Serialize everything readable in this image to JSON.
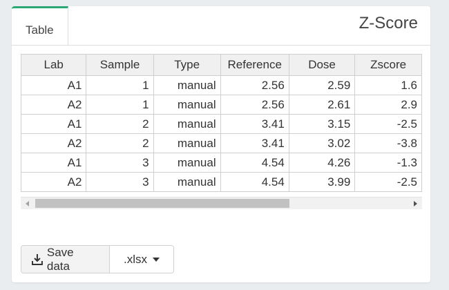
{
  "tabs": [
    {
      "label": "Table"
    }
  ],
  "panel": {
    "title": "Z-Score"
  },
  "table": {
    "columns": [
      "Lab",
      "Sample",
      "Type",
      "Reference",
      "Dose",
      "Zscore"
    ],
    "rows": [
      [
        "A1",
        "1",
        "manual",
        "2.56",
        "2.59",
        "1.6"
      ],
      [
        "A2",
        "1",
        "manual",
        "2.56",
        "2.61",
        "2.9"
      ],
      [
        "A1",
        "2",
        "manual",
        "3.41",
        "3.15",
        "-2.5"
      ],
      [
        "A2",
        "2",
        "manual",
        "3.41",
        "3.02",
        "-3.8"
      ],
      [
        "A1",
        "3",
        "manual",
        "4.54",
        "4.26",
        "-1.3"
      ],
      [
        "A2",
        "3",
        "manual",
        "4.54",
        "3.99",
        "-2.5"
      ]
    ]
  },
  "actions": {
    "save_label": "Save data",
    "format_label": ".xlsx"
  },
  "icons": {
    "save": "download-icon",
    "format": "caret-down-icon"
  },
  "colors": {
    "accent": "#27a874"
  }
}
